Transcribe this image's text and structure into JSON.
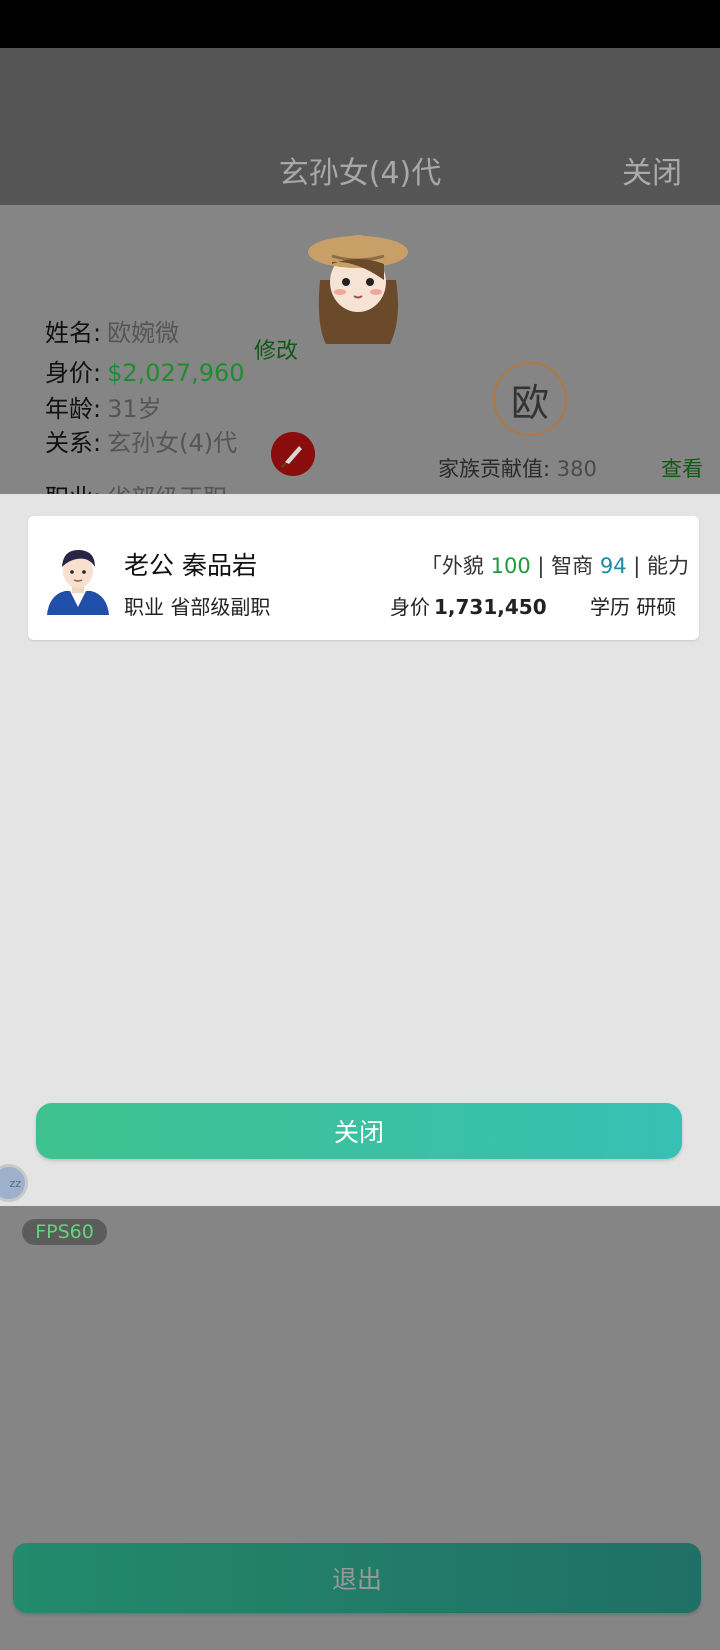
{
  "header": {
    "title": "玄孙女(4)代",
    "close_label": "关闭"
  },
  "profile": {
    "name_label": "姓名:",
    "name_value": "欧婉微",
    "edit_label": "修改",
    "worth_label": "身价:",
    "worth_value": "$2,027,960",
    "age_label": "年龄:",
    "age_value": "31岁",
    "relation_label": "关系:",
    "relation_value": "玄孙女(4)代",
    "job_label": "职业:",
    "job_value": "省部级正职",
    "clan_char": "欧",
    "contribution_label": "家族贡献值:",
    "contribution_value": "380",
    "view_label": "查看"
  },
  "spouse": {
    "title": "老公 秦品岩",
    "stats_prefix": "「外貌 ",
    "appearance_value": "100",
    "sep1": " | ",
    "iq_label": "智商 ",
    "iq_value": "94",
    "sep2": " | ",
    "ability_label": "能力",
    "job_label": "职业",
    "job_value": "省部级副职",
    "worth_label": "身价",
    "worth_value": "1,731,450",
    "edu_label": "学历",
    "edu_value": "研硕"
  },
  "modal": {
    "close_button": "关闭"
  },
  "overlay": {
    "fps_label": "FPS60",
    "float_ball_text": "zz"
  },
  "footer": {
    "exit_button": "退出"
  },
  "colors": {
    "button_teal": "#3ec28f",
    "money_green": "#1f8c2f",
    "header_gray": "#555555"
  }
}
